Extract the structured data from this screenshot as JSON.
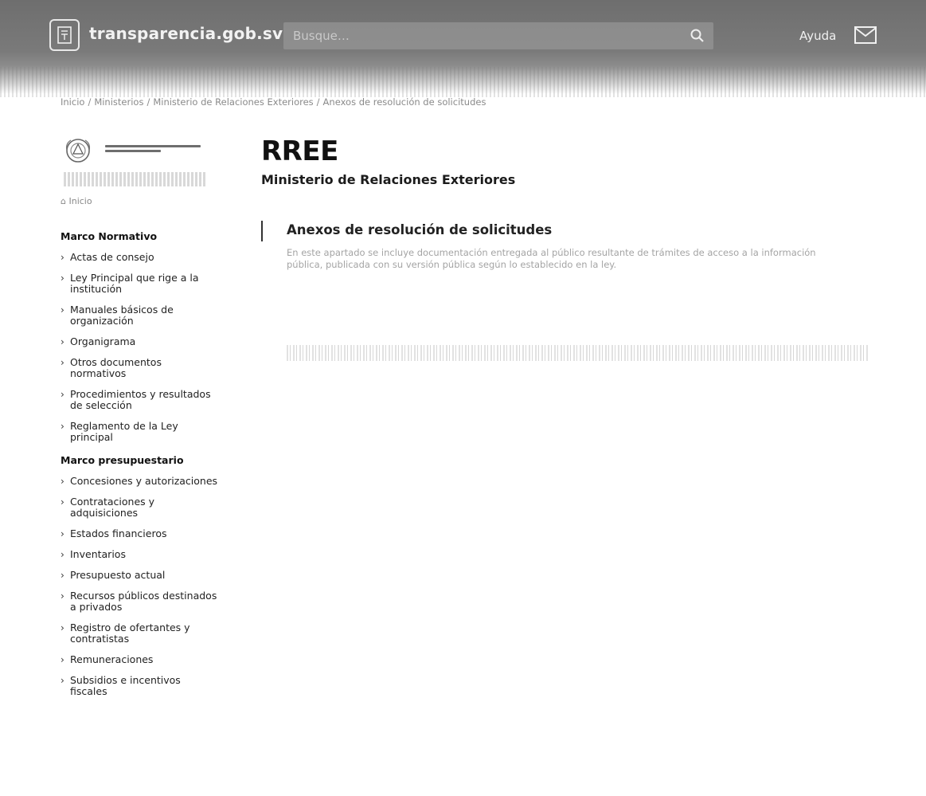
{
  "header": {
    "site_name": "transparencia.gob.sv",
    "search_placeholder": "Busque…",
    "help_label": "Ayuda"
  },
  "breadcrumb": [
    "Inicio",
    "Ministerios",
    "Ministerio de Relaciones Exteriores",
    "Anexos de resolución de solicitudes"
  ],
  "sidebar": {
    "home_label": "Inicio",
    "sections": [
      {
        "title": "Marco Normativo",
        "items": [
          "Actas de consejo",
          "Ley Principal que rige a la institución",
          "Manuales básicos de organización",
          "Organigrama",
          "Otros documentos normativos",
          "Procedimientos y resultados de selección",
          "Reglamento de la Ley principal"
        ]
      },
      {
        "title": "Marco presupuestario",
        "items": [
          "Concesiones y autorizaciones",
          "Contrataciones y adquisiciones",
          "Estados financieros",
          "Inventarios",
          "Presupuesto actual",
          "Recursos públicos destinados a privados",
          "Registro de ofertantes y contratistas",
          "Remuneraciones",
          "Subsidios e incentivos fiscales"
        ]
      }
    ]
  },
  "main": {
    "title": "RREE",
    "subtitle": "Ministerio de Relaciones Exteriores",
    "section_title": "Anexos de resolución de solicitudes",
    "description": "En este apartado se incluye documentación entregada al público resultante de trámites de acceso a la información pública, publicada con su versión pública según lo establecido en la ley."
  }
}
